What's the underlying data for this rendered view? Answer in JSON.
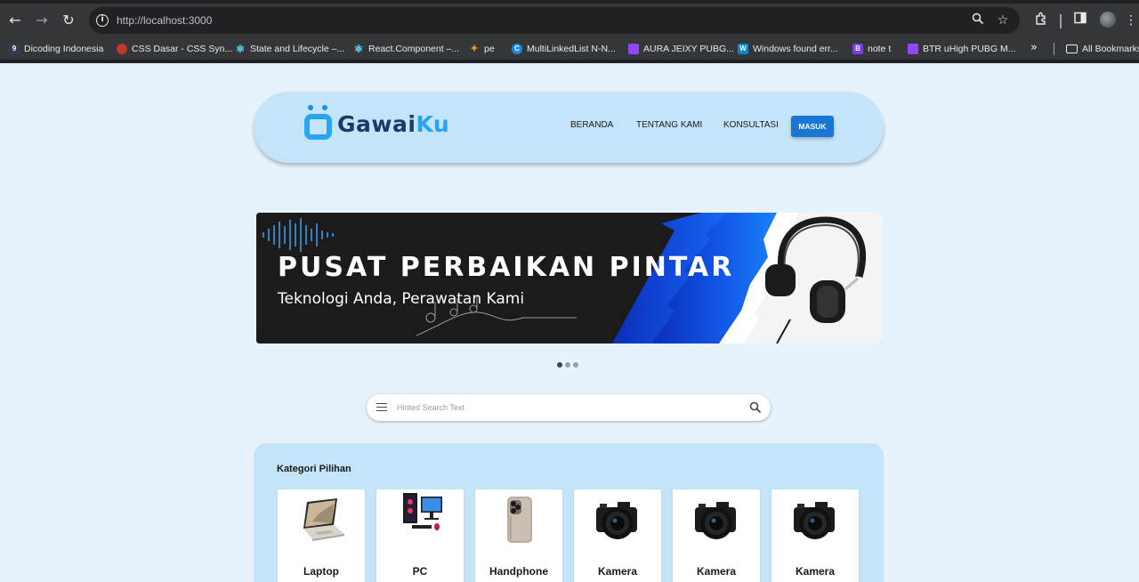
{
  "browser": {
    "url": "http://localhost:3000",
    "bookmarks": [
      {
        "label": "Dicoding Indonesia",
        "icon": "dicoding-icon",
        "color": "#2d3e50"
      },
      {
        "label": "CSS Dasar - CSS Syn...",
        "icon": "css-icon",
        "color": "#c0392b"
      },
      {
        "label": "State and Lifecycle –...",
        "icon": "react-icon",
        "color": "#61dafb"
      },
      {
        "label": "React.Component –...",
        "icon": "react-icon",
        "color": "#61dafb"
      },
      {
        "label": "pe",
        "icon": "pe-icon",
        "color": "#f39c12"
      },
      {
        "label": "MultiLinkedList N-N...",
        "icon": "c-icon",
        "color": "#1e88e5"
      },
      {
        "label": "AURA JEIXY PUBG...",
        "icon": "twitch-icon",
        "color": "#9146ff"
      },
      {
        "label": "Windows found err...",
        "icon": "w-icon",
        "color": "#0288d1"
      },
      {
        "label": "note t",
        "icon": "b-icon",
        "color": "#7c3aed"
      },
      {
        "label": "BTR uHigh PUBG M...",
        "icon": "twitch-icon",
        "color": "#9146ff"
      }
    ],
    "all_bookmarks_label": "All Bookmarks"
  },
  "header": {
    "logo_text_main": "Gawai",
    "logo_text_accent": "Ku",
    "nav": [
      "BERANDA",
      "TENTANG KAMI",
      "KONSULTASI"
    ],
    "login_label": "MASUK"
  },
  "banner": {
    "title": "PUSAT PERBAIKAN PINTAR",
    "subtitle": "Teknologi Anda, Perawatan Kami",
    "slide_count": 3,
    "active_slide": 1
  },
  "search": {
    "placeholder": "Hinted Search Text"
  },
  "categories": {
    "title": "Kategori Pilihan",
    "items": [
      {
        "label": "Laptop",
        "icon": "laptop-icon"
      },
      {
        "label": "PC",
        "icon": "pc-icon"
      },
      {
        "label": "Handphone",
        "icon": "phone-icon"
      },
      {
        "label": "Kamera",
        "icon": "camera-icon"
      },
      {
        "label": "Kamera",
        "icon": "camera-icon"
      },
      {
        "label": "Kamera",
        "icon": "camera-icon"
      }
    ]
  },
  "colors": {
    "page_bg": "#e6f3fd",
    "header_bg": "#c4e4fa",
    "primary": "#1976d2",
    "logo_dark": "#1a3a6b",
    "logo_accent": "#29a4f0"
  }
}
